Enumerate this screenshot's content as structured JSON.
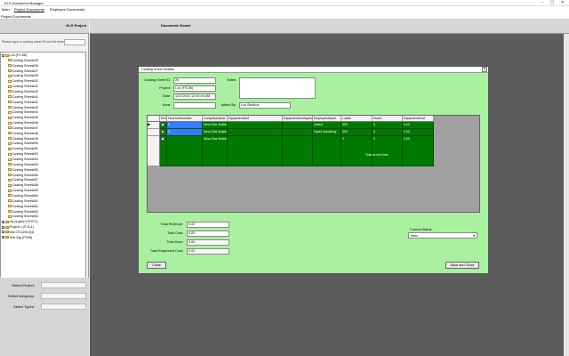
{
  "window": {
    "title": "KLS Document Manager",
    "controls": "–  ▢  ✕"
  },
  "menu": {
    "items": [
      "Main",
      "Project Documents",
      "Employee Documents"
    ]
  },
  "tabstrip": {
    "title": "Project Documents"
  },
  "left_pane": {
    "header": "KLS Project",
    "search_label": "Please type in costing sheet ID and hit enter",
    "tree": [
      {
        "label": "Lou (FS-56)",
        "level": 0,
        "expander": "−",
        "folder": true
      },
      {
        "label": "Costing Sheet#25",
        "level": 1
      },
      {
        "label": "Costing Sheet#26",
        "level": 1
      },
      {
        "label": "Costing Sheet#27",
        "level": 1
      },
      {
        "label": "Costing Sheet#28",
        "level": 1
      },
      {
        "label": "Costing Sheet#31",
        "level": 1
      },
      {
        "label": "Costing Sheet#32",
        "level": 1
      },
      {
        "label": "Costing Sheet#40",
        "level": 1
      },
      {
        "label": "Costing Sheet#41",
        "level": 1
      },
      {
        "label": "Costing Sheet#42",
        "level": 1
      },
      {
        "label": "Costing Sheet#43",
        "level": 1
      },
      {
        "label": "Costing Sheet#44",
        "level": 1
      },
      {
        "label": "Costing Sheet#45",
        "level": 1
      },
      {
        "label": "Costing Sheet#46",
        "level": 1
      },
      {
        "label": "Costing Sheet#47",
        "level": 1
      },
      {
        "label": "Costing Sheet#48",
        "level": 1
      },
      {
        "label": "Costing Sheet#49",
        "level": 1
      },
      {
        "label": "Costing Sheet#50",
        "level": 1
      },
      {
        "label": "Costing Sheet#51",
        "level": 1
      },
      {
        "label": "Costing Sheet#52",
        "level": 1
      },
      {
        "label": "Costing Sheet#53",
        "level": 1
      },
      {
        "label": "Costing Sheet#54",
        "level": 1
      },
      {
        "label": "Costing Sheet#55",
        "level": 1
      },
      {
        "label": "Costing Sheet#56",
        "level": 1
      },
      {
        "label": "Costing Sheet#57",
        "level": 1
      },
      {
        "label": "Costing Sheet#58",
        "level": 1
      },
      {
        "label": "Costing Sheet#59",
        "level": 1
      },
      {
        "label": "Costing Sheet#60",
        "level": 1
      },
      {
        "label": "Costing Sheet#61",
        "level": 1
      },
      {
        "label": "Costing Sheet#62",
        "level": 1
      },
      {
        "label": "Costing Sheet#63",
        "level": 1
      },
      {
        "label": "Costing Sheet#64",
        "level": 1
      },
      {
        "label": "my project (TEST1)",
        "level": 0,
        "expander": "+",
        "folder": true
      },
      {
        "label": "Project 1 (P-A-1)",
        "level": 0,
        "expander": "+",
        "folder": true
      },
      {
        "label": "test 07122010(4)",
        "level": 0,
        "expander": "+",
        "folder": true
      },
      {
        "label": "Test Stg (FS30)",
        "level": 0,
        "expander": "+",
        "folder": true
      }
    ],
    "filters": [
      {
        "label": "Select Project:",
        "value": ""
      },
      {
        "label": "Select subgroup:",
        "value": ""
      },
      {
        "label": "Select Types:",
        "value": ""
      }
    ]
  },
  "right_pane": {
    "header": "Document Viewer"
  },
  "dialog": {
    "title": "Costing Sheet Details",
    "close_icon": "✕",
    "fields": {
      "sheet_id": {
        "label": "Costing Sheet ID:",
        "value": "28"
      },
      "project": {
        "label": "Project:",
        "value": "Lou (FS-56)"
      },
      "date": {
        "label": "Date:",
        "value": "12/2/2010 12:00:00 AM"
      },
      "area": {
        "label": "Area:",
        "value": ""
      },
      "notes": {
        "label": "Notes:",
        "value": ""
      },
      "added_by": {
        "label": "Added By:",
        "value": "Lou Boutros"
      }
    },
    "grid": {
      "columns": [
        "Reviewed?",
        "HourCertNumber",
        "CompanyName",
        "EquipmentUnit",
        "EquipmentConfigure",
        "EmployeeName",
        "Loads",
        "Hours",
        "EquipmentCost"
      ],
      "rows": [
        {
          "marker": "▶",
          "reviewed": false,
          "cells": [
            "",
            "0",
            "Nova Star Building Systems",
            "",
            "",
            "Zahed",
            "500",
            "0",
            "0.00"
          ]
        },
        {
          "marker": "",
          "reviewed": true,
          "cells": [
            "",
            "0",
            "Nova Star Building Systems",
            "",
            "",
            "Danld Sandberg",
            "500",
            "0",
            "0.00"
          ]
        },
        {
          "marker": "",
          "reviewed": false,
          "cells": [
            "",
            "",
            "Nova Star Building Sy systm",
            "",
            "",
            "",
            "0",
            "0",
            "0.00"
          ]
        }
      ],
      "extra_text": "Total at end time"
    },
    "totals": [
      {
        "label": "Total Revenue:",
        "value": "0.00"
      },
      {
        "label": "Total Cost:",
        "value": "0.00"
      },
      {
        "label": "Total Hour:",
        "value": "0.00"
      },
      {
        "label": "Total Equipment Cost:",
        "value": "0.00"
      }
    ],
    "status": {
      "label": "Current Status",
      "value": "New"
    },
    "buttons": {
      "close": "Close",
      "save_close": "Save and Close"
    }
  }
}
